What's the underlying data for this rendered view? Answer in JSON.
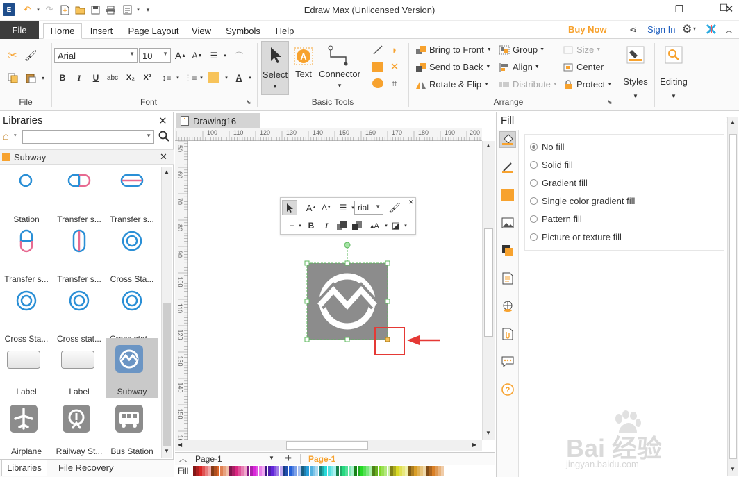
{
  "app": {
    "title": "Edraw Max (Unlicensed Version)",
    "buy_now": "Buy Now",
    "sign_in": "Sign In"
  },
  "menu_tabs": [
    "File",
    "Home",
    "Insert",
    "Page Layout",
    "View",
    "Symbols",
    "Help"
  ],
  "ribbon": {
    "file_group": "File",
    "font_group": "Font",
    "font_name": "Arial",
    "font_size": "10",
    "basic_tools_group": "Basic Tools",
    "select_label": "Select",
    "text_label": "Text",
    "connector_label": "Connector",
    "arrange_group": "Arrange",
    "bring_to_front": "Bring to Front",
    "send_to_back": "Send to Back",
    "rotate_flip": "Rotate & Flip",
    "group": "Group",
    "align": "Align",
    "distribute": "Distribute",
    "size": "Size",
    "center": "Center",
    "protect": "Protect",
    "styles": "Styles",
    "editing": "Editing",
    "bold": "B",
    "italic": "I",
    "underline": "U",
    "strike": "abc",
    "subscript": "X₂",
    "superscript": "X²"
  },
  "libraries": {
    "title": "Libraries",
    "category": "Subway",
    "items": [
      {
        "label": "Station"
      },
      {
        "label": "Transfer s..."
      },
      {
        "label": "Transfer s..."
      },
      {
        "label": "Transfer s..."
      },
      {
        "label": "Transfer s..."
      },
      {
        "label": "Cross Sta..."
      },
      {
        "label": "Cross Sta..."
      },
      {
        "label": "Cross stat..."
      },
      {
        "label": "Cross stat..."
      },
      {
        "label": "Label"
      },
      {
        "label": "Label"
      },
      {
        "label": "Subway"
      },
      {
        "label": "Airplane"
      },
      {
        "label": "Railway St..."
      },
      {
        "label": "Bus Station"
      }
    ],
    "bottom_tabs": [
      "Libraries",
      "File Recovery"
    ]
  },
  "document": {
    "tab_name": "Drawing16",
    "ruler_h": [
      "100",
      "110",
      "120",
      "130",
      "140",
      "150",
      "160",
      "170",
      "180",
      "190",
      "200"
    ],
    "ruler_v": [
      "50",
      "60",
      "70",
      "80",
      "90",
      "100",
      "110",
      "120",
      "130",
      "140",
      "150",
      "160"
    ],
    "floatbar_font": "rial",
    "page_select": "Page-1",
    "page_tab": "Page-1",
    "fill_label": "Fill"
  },
  "fill_panel": {
    "title": "Fill",
    "options": [
      "No fill",
      "Solid fill",
      "Gradient fill",
      "Single color gradient fill",
      "Pattern fill",
      "Picture or texture fill"
    ],
    "selected": "No fill"
  },
  "watermark": {
    "text": "Bai 经验",
    "url": "jingyan.baidu.com"
  },
  "colors": {
    "accent_orange": "#f7a22e",
    "file_tab_bg": "#3c3c3c",
    "shape_fill": "#8c8c8c",
    "selection_green": "#5cb85c",
    "annotation_red": "#e53935"
  }
}
